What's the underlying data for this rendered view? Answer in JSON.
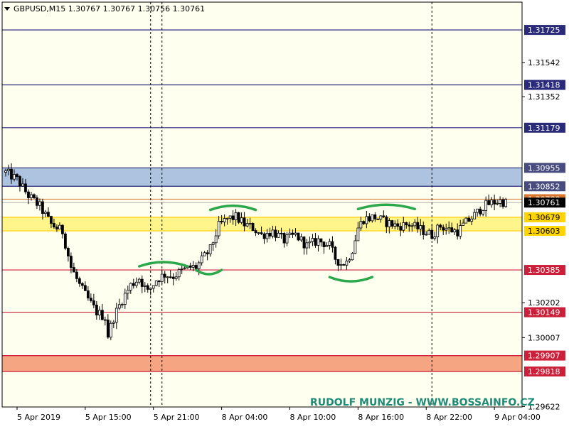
{
  "header": {
    "info": "GBPUSD,M15  1.30767 1.30767 1.30756 1.30761",
    "menu_icon": "triangle-down-icon"
  },
  "watermark": "RUDOLF MUNZIG - WWW.BOSSAINFO.CZ",
  "colors": {
    "background": "#fffff0",
    "candle": "#000000",
    "blue_zone": "#adc3e0",
    "yellow_zone": "#fff58a",
    "orange_zone": "#f5a582",
    "navy_line": "#2a2a7a",
    "red_line": "#cc1f3a",
    "pattern": "#2aa84a",
    "watermark": "#1f8a78"
  },
  "chart_data": {
    "type": "candlestick",
    "symbol": "GBPUSD",
    "timeframe": "M15",
    "ylim": [
      1.2962,
      1.3188
    ],
    "price_ticks": [
      "1.31542",
      "1.31352",
      "1.30202",
      "1.30007",
      "1.29622"
    ],
    "time_ticks": [
      "5 Apr 2019",
      "5 Apr 15:00",
      "5 Apr 21:00",
      "8 Apr 04:00",
      "8 Apr 10:00",
      "8 Apr 16:00",
      "8 Apr 22:00",
      "9 Apr 04:00"
    ],
    "level_lines": [
      {
        "price": 1.31725,
        "label": "1.31725",
        "kind": "navy"
      },
      {
        "price": 1.31418,
        "label": "1.31418",
        "kind": "navy"
      },
      {
        "price": 1.31179,
        "label": "1.31179",
        "kind": "navy"
      },
      {
        "price": 1.30385,
        "label": "1.30385",
        "kind": "red"
      },
      {
        "price": 1.30149,
        "label": "1.30149",
        "kind": "red"
      },
      {
        "price": 1.29907,
        "label": "1.29907",
        "kind": "red"
      },
      {
        "price": 1.29818,
        "label": "1.29818",
        "kind": "red"
      }
    ],
    "zones": [
      {
        "from": 1.30852,
        "to": 1.30955,
        "kind": "blue",
        "labels": [
          "1.30955",
          "1.30852"
        ]
      },
      {
        "from": 1.30603,
        "to": 1.30679,
        "kind": "yellow",
        "labels": [
          "1.30679",
          "1.30603"
        ]
      },
      {
        "from": 1.29818,
        "to": 1.29907,
        "kind": "orange",
        "labels": []
      }
    ],
    "current_price": {
      "price": 1.30761,
      "label": "1.30761"
    },
    "ask_line": {
      "price": 1.3078,
      "label": "1.30780"
    },
    "close_path": [
      [
        0,
        1.3093
      ],
      [
        4,
        1.3089
      ],
      [
        8,
        1.308
      ],
      [
        12,
        1.3074
      ],
      [
        16,
        1.3064
      ],
      [
        20,
        1.306
      ],
      [
        23,
        1.304
      ],
      [
        26,
        1.303
      ],
      [
        29,
        1.3022
      ],
      [
        32,
        1.3015
      ],
      [
        35,
        1.3012
      ],
      [
        36,
        1.3002
      ],
      [
        38,
        1.3012
      ],
      [
        41,
        1.3022
      ],
      [
        44,
        1.303
      ],
      [
        47,
        1.3034
      ],
      [
        50,
        1.3026
      ],
      [
        53,
        1.3033
      ],
      [
        56,
        1.3036
      ],
      [
        59,
        1.3035
      ],
      [
        62,
        1.3038
      ],
      [
        65,
        1.304
      ],
      [
        67,
        1.304
      ],
      [
        69,
        1.3044
      ],
      [
        72,
        1.305
      ],
      [
        75,
        1.3063
      ],
      [
        78,
        1.3067
      ],
      [
        81,
        1.3068
      ],
      [
        84,
        1.3064
      ],
      [
        87,
        1.3062
      ],
      [
        90,
        1.3058
      ],
      [
        94,
        1.306
      ],
      [
        98,
        1.3055
      ],
      [
        102,
        1.3058
      ],
      [
        106,
        1.3052
      ],
      [
        110,
        1.3055
      ],
      [
        114,
        1.3052
      ],
      [
        116,
        1.3045
      ],
      [
        118,
        1.3042
      ],
      [
        120,
        1.3043
      ],
      [
        122,
        1.305
      ],
      [
        124,
        1.3062
      ],
      [
        126,
        1.3067
      ],
      [
        130,
        1.3068
      ],
      [
        134,
        1.3065
      ],
      [
        138,
        1.3063
      ],
      [
        142,
        1.3064
      ],
      [
        146,
        1.3061
      ],
      [
        150,
        1.3058
      ],
      [
        153,
        1.3063
      ],
      [
        156,
        1.3061
      ],
      [
        159,
        1.306
      ],
      [
        162,
        1.3065
      ],
      [
        165,
        1.3069
      ],
      [
        168,
        1.3074
      ],
      [
        171,
        1.3076
      ],
      [
        174,
        1.3077
      ],
      [
        176,
        1.3076
      ]
    ],
    "shoulder_arcs": [
      {
        "shape": "arch",
        "from": 47,
        "to": 64,
        "price": 1.30405
      },
      {
        "shape": "cup",
        "from": 67,
        "to": 76,
        "price": 1.30385
      },
      {
        "shape": "arch",
        "from": 72,
        "to": 88,
        "price": 1.3072
      },
      {
        "shape": "cup",
        "from": 114,
        "to": 129,
        "price": 1.30345
      },
      {
        "shape": "arch",
        "from": 124,
        "to": 144,
        "price": 1.30725
      }
    ],
    "vertical_markers": [
      51,
      55,
      150
    ]
  }
}
